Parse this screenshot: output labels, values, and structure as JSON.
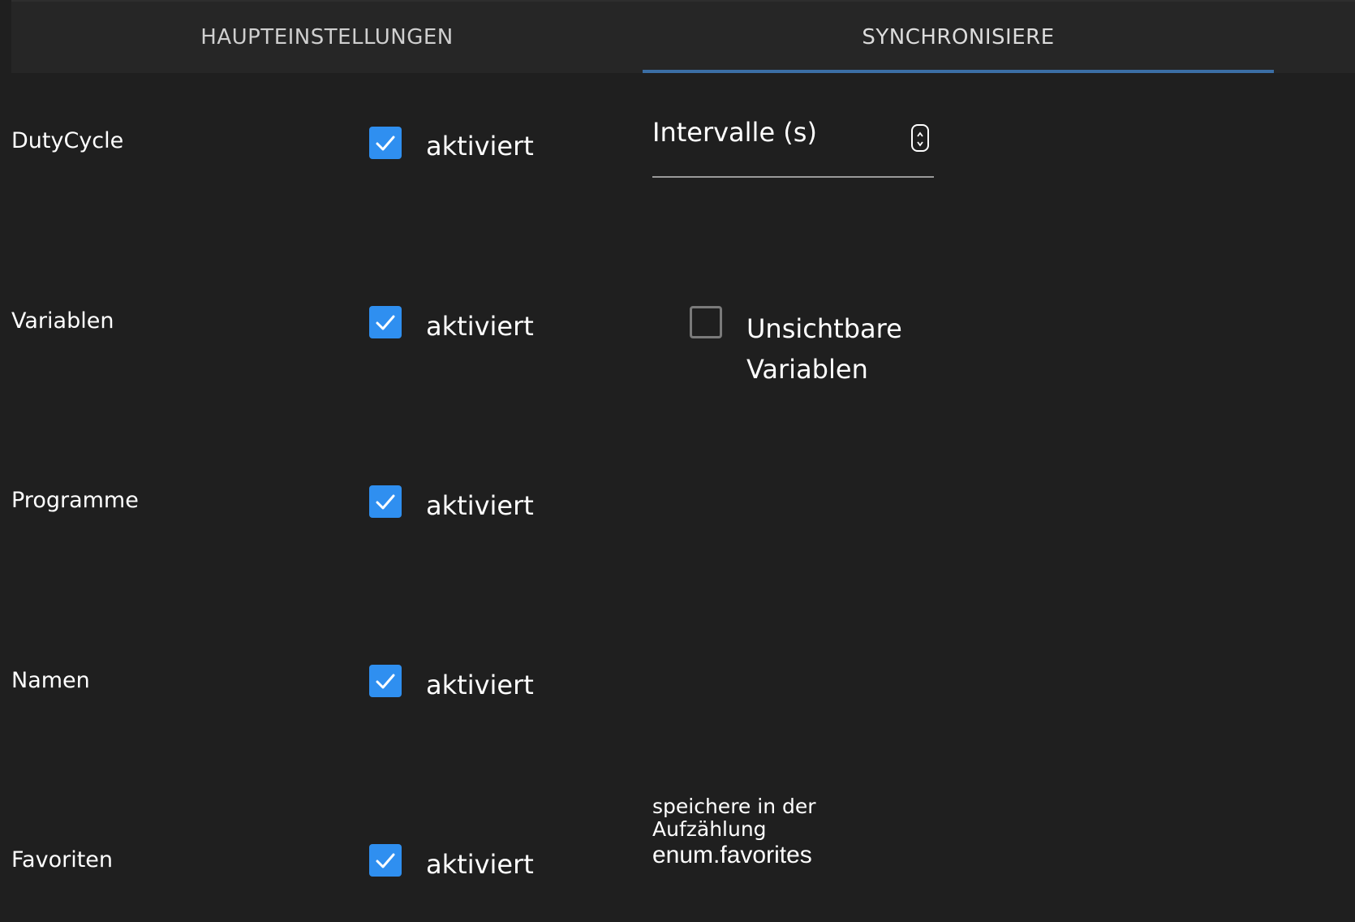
{
  "tabs": [
    {
      "label": "HAUPTEINSTELLUNGEN",
      "active": false
    },
    {
      "label": "SYNCHRONISIERE",
      "active": true
    }
  ],
  "colors": {
    "background": "#1f1f1f",
    "tabbar": "#262626",
    "accent": "#2f8ff0",
    "tab_indicator": "#3b6ea5"
  },
  "rows": [
    {
      "label": "DutyCycle",
      "checkbox_label": "aktiviert",
      "checked": true
    },
    {
      "label": "Variablen",
      "checkbox_label": "aktiviert",
      "checked": true
    },
    {
      "label": "Programme",
      "checkbox_label": "aktiviert",
      "checked": true
    },
    {
      "label": "Namen",
      "checkbox_label": "aktiviert",
      "checked": true
    },
    {
      "label": "Favoriten",
      "checkbox_label": "aktiviert",
      "checked": true
    }
  ],
  "interval": {
    "label": "Intervalle (s)",
    "value": ""
  },
  "hidden_variables": {
    "label": "Unsichtbare Variablen",
    "checked": false
  },
  "favorites_enum": {
    "label": "speichere in der Aufzählung",
    "value": "enum.favorites"
  }
}
